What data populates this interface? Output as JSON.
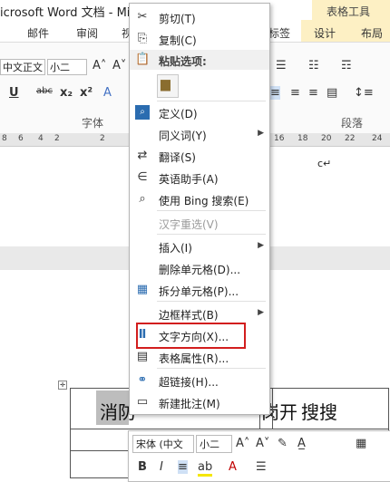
{
  "titlebar": {
    "title": "icrosoft Word 文档 - Mic",
    "table_tools": "表格工具"
  },
  "tabs": [
    "邮件",
    "审阅",
    "视",
    "标签",
    "设计",
    "布局"
  ],
  "ribbon": {
    "font_name": "中文正文",
    "font_size": "小二",
    "font_group_label": "字体",
    "paragraph_group_label": "段落"
  },
  "ruler": {
    "left_ticks": [
      "8",
      "6",
      "4",
      "2",
      "2",
      "4"
    ],
    "right_ticks": [
      "16",
      "18",
      "20",
      "22",
      "24"
    ]
  },
  "document": {
    "para_mark": "c↵",
    "cell_texts": [
      "消防",
      "防",
      "岗开",
      "搜搜"
    ]
  },
  "menu": {
    "items": [
      {
        "label": "剪切(T)",
        "icon": "scissors-icon",
        "glyph": "✂",
        "disabled": false
      },
      {
        "label": "复制(C)",
        "icon": "copy-icon",
        "glyph": "⎘",
        "disabled": false
      },
      {
        "label": "粘贴选项:",
        "icon": "paste-icon",
        "glyph": "📋",
        "header": true
      },
      {
        "label": "定义(D)",
        "icon": "define-icon",
        "glyph": "🔍",
        "disabled": false
      },
      {
        "label": "同义词(Y)",
        "icon": "",
        "glyph": "",
        "disabled": false,
        "submenu": true
      },
      {
        "label": "翻译(S)",
        "icon": "translate-icon",
        "glyph": "⇄",
        "disabled": false
      },
      {
        "label": "英语助手(A)",
        "icon": "english-assistant-icon",
        "glyph": "∈",
        "disabled": false
      },
      {
        "label": "使用 Bing 搜索(E)",
        "icon": "bing-search-icon",
        "glyph": "⌕",
        "disabled": false
      },
      {
        "label": "汉字重选(V)",
        "icon": "",
        "glyph": "",
        "disabled": true
      },
      {
        "label": "插入(I)",
        "icon": "",
        "glyph": "",
        "disabled": false,
        "submenu": true
      },
      {
        "label": "删除单元格(D)...",
        "icon": "",
        "glyph": "",
        "disabled": false
      },
      {
        "label": "拆分单元格(P)...",
        "icon": "split-cells-icon",
        "glyph": "▦",
        "disabled": false
      },
      {
        "label": "边框样式(B)",
        "icon": "",
        "glyph": "",
        "disabled": false,
        "submenu": true
      },
      {
        "label": "文字方向(X)...",
        "icon": "text-direction-icon",
        "glyph": "Ⅱ",
        "disabled": false
      },
      {
        "label": "表格属性(R)...",
        "icon": "table-properties-icon",
        "glyph": "▤",
        "disabled": false
      },
      {
        "label": "超链接(H)...",
        "icon": "hyperlink-icon",
        "glyph": "⚭",
        "disabled": false
      },
      {
        "label": "新建批注(M)",
        "icon": "new-comment-icon",
        "glyph": "▭",
        "disabled": false
      }
    ]
  },
  "mini_toolbar": {
    "font_name": "宋体 (中文",
    "font_size": "小二",
    "style_label": "样式",
    "bold": "B",
    "italic": "I"
  }
}
